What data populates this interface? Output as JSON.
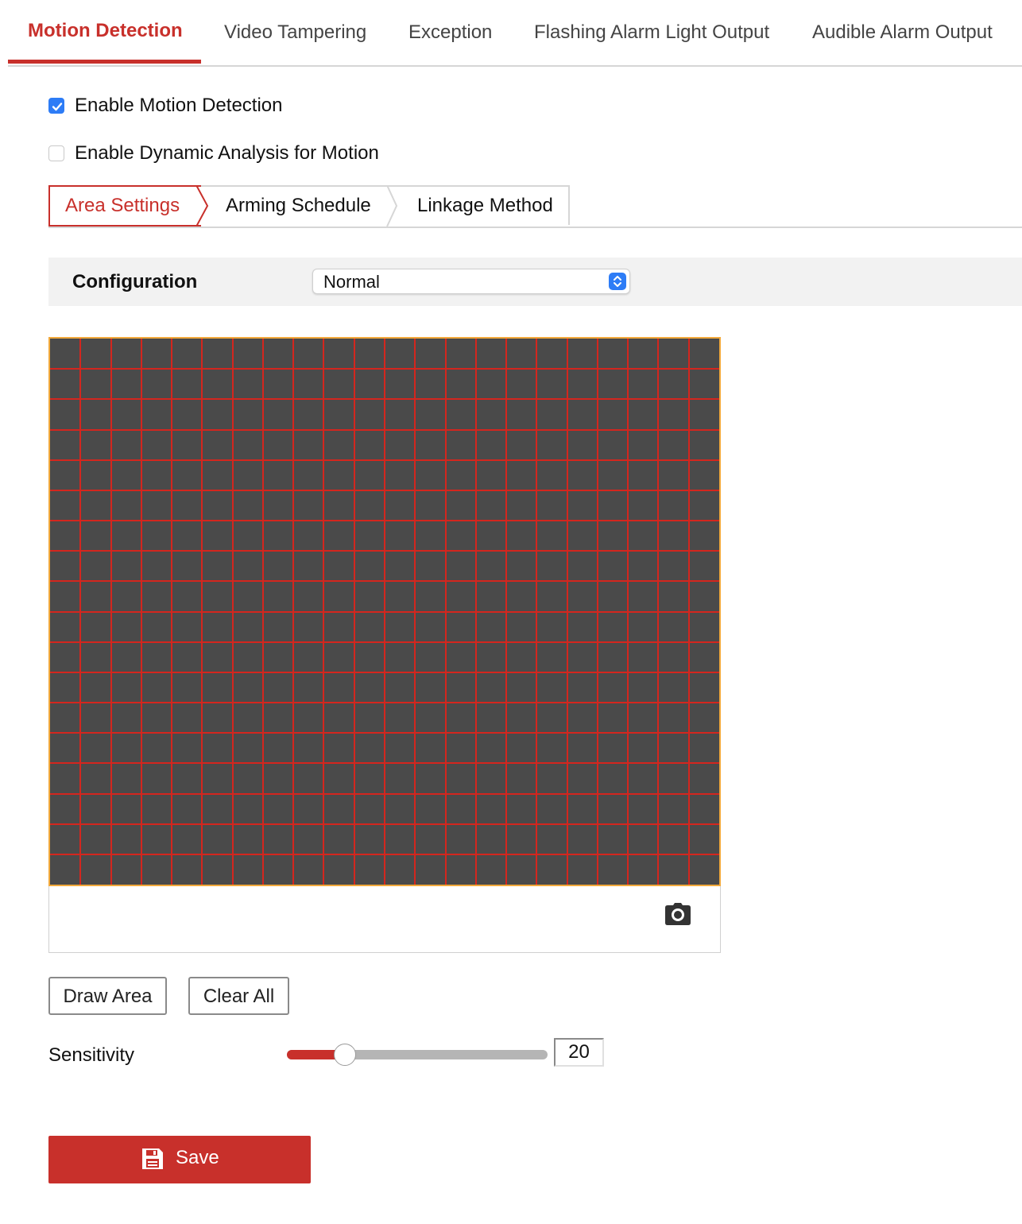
{
  "top_tabs": [
    {
      "label": "Motion Detection",
      "active": true
    },
    {
      "label": "Video Tampering",
      "active": false
    },
    {
      "label": "Exception",
      "active": false
    },
    {
      "label": "Flashing Alarm Light Output",
      "active": false
    },
    {
      "label": "Audible Alarm Output",
      "active": false
    }
  ],
  "options": {
    "enable_motion": {
      "label": "Enable Motion Detection",
      "checked": true
    },
    "enable_dynamic": {
      "label": "Enable Dynamic Analysis for Motion",
      "checked": false
    }
  },
  "sub_tabs": [
    {
      "label": "Area Settings",
      "active": true
    },
    {
      "label": "Arming Schedule",
      "active": false
    },
    {
      "label": "Linkage Method",
      "active": false
    }
  ],
  "configuration": {
    "label": "Configuration",
    "value": "Normal"
  },
  "motion_grid": {
    "columns": 22,
    "rows": 18,
    "cell_color": "#4a4a4a",
    "line_color": "#d4261e",
    "border_color": "#f2a93b"
  },
  "toolbar": {
    "snapshot_icon": "camera-icon"
  },
  "buttons": {
    "draw_area": "Draw Area",
    "clear_all": "Clear All"
  },
  "sensitivity": {
    "label": "Sensitivity",
    "value": "20",
    "fraction": 0.2
  },
  "save": {
    "label": "Save",
    "icon": "save-icon",
    "color": "#c8302b"
  },
  "colors": {
    "accent": "#c8302b",
    "checkbox_blue": "#2d7cf6"
  }
}
